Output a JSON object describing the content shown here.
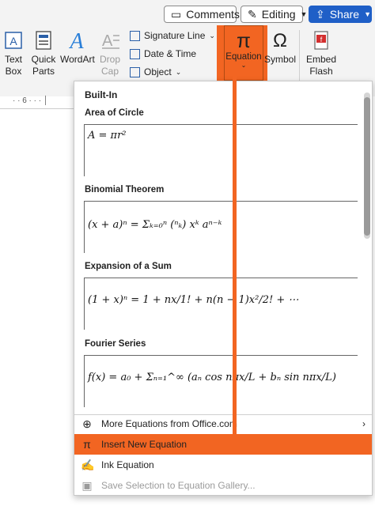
{
  "topbar": {
    "comments_label": "Comments",
    "editing_label": "Editing",
    "share_label": "Share"
  },
  "ribbon": {
    "textbox_label": "Text\nBox",
    "quickparts_label": "Quick\nParts",
    "wordart_label": "WordArt",
    "dropcap_label": "Drop\nCap",
    "signature_label": "Signature Line",
    "datetime_label": "Date & Time",
    "object_label": "Object",
    "equation_label": "Equation",
    "equation_symbol": "π",
    "symbol_label": "Symbol",
    "symbol_glyph": "Ω",
    "embed_label": "Embed\nFlash"
  },
  "ruler": {
    "mark": "6"
  },
  "dropdown": {
    "header": "Built-In",
    "sections": [
      {
        "title": "Area of Circle",
        "formula": "A = πr²"
      },
      {
        "title": "Binomial Theorem",
        "formula": "(x + a)ⁿ = Σₖ₌₀ⁿ (ⁿₖ) xᵏ aⁿ⁻ᵏ"
      },
      {
        "title": "Expansion of a Sum",
        "formula": "(1 + x)ⁿ = 1 + nx/1! + n(n − 1)x²/2! + ⋯"
      },
      {
        "title": "Fourier Series",
        "formula": "f(x) = a₀ + Σₙ₌₁^∞ (aₙ cos nπx/L + bₙ sin nπx/L)"
      }
    ],
    "items": [
      {
        "label": "More Equations from Office.com",
        "icon": "globe-icon"
      },
      {
        "label": "Insert New Equation",
        "icon": "pi-icon"
      },
      {
        "label": "Ink Equation",
        "icon": "ink-icon"
      },
      {
        "label": "Save Selection to Equation Gallery...",
        "icon": "save-icon"
      }
    ]
  },
  "colors": {
    "highlight": "#f26522",
    "share": "#1f5fc7"
  }
}
